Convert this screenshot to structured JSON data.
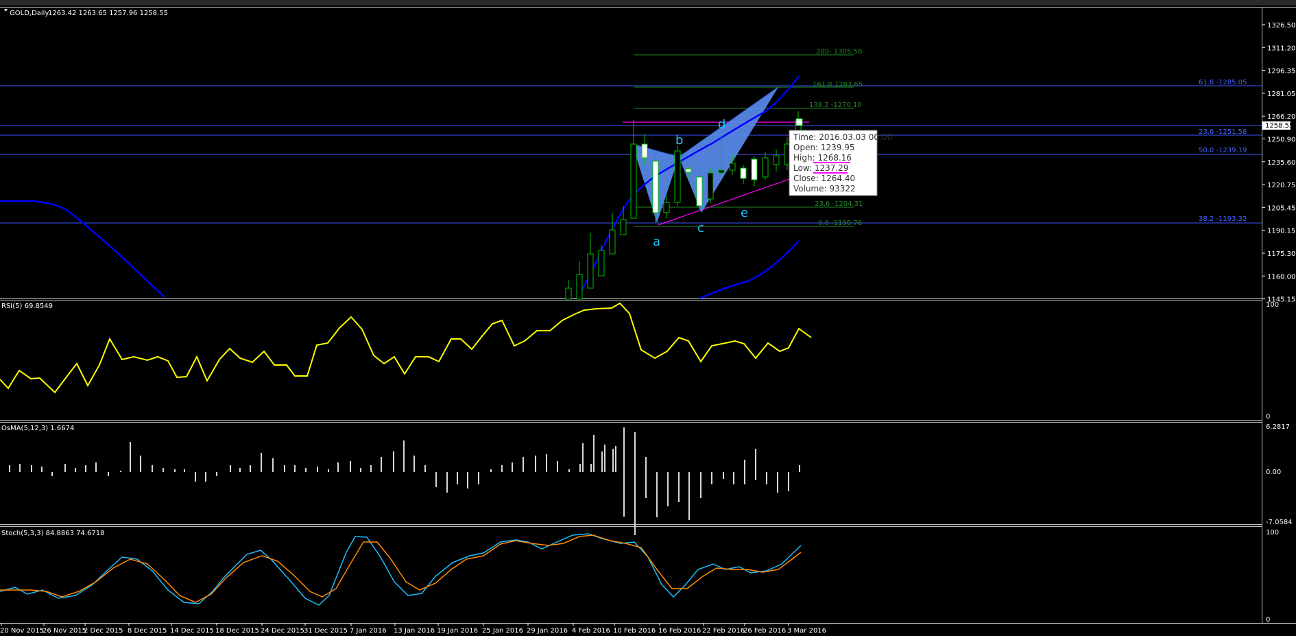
{
  "main": {
    "title": "GOLD,Daily",
    "ohlc": "1263.42 1263.65 1257.96 1258.55",
    "current_price": "1258.55",
    "price_axis": [
      "1326.50",
      "1311.20",
      "1296.35",
      "1281.05",
      "1266.20",
      "1250.90",
      "1235.60",
      "1220.75",
      "1205.45",
      "1190.15",
      "1175.30",
      "1160.00",
      "1145.15"
    ],
    "fib_green": [
      "200- 1305.58",
      "161.8 1283.65",
      "138.2 -1270.10",
      "23.6 -1204.31",
      "0.0 -1190.76"
    ],
    "fib_blue": [
      "61.8 -1285.05",
      "23.6 -1251.58",
      "50.0 -1239.19",
      "38.2 -1193.32"
    ],
    "wave_labels": [
      "a",
      "b",
      "c",
      "d",
      "e"
    ],
    "tooltip": {
      "time": "Time: 2016.03.03 00:00",
      "open": "Open: 1239.95",
      "high": "High: 1268.16",
      "low": "Low:  1237.29",
      "close": "Close: 1264.40",
      "volume": "Volume: 93322"
    }
  },
  "rsi": {
    "title": "RSI(5) 69.8549",
    "max": "100",
    "min": "0"
  },
  "osma": {
    "title": "OsMA(5,12,3) 1.6674",
    "max": "6.2817",
    "mid": "0.00",
    "min": "-7.0584"
  },
  "stoch": {
    "title": "Stoch(5,3,3) 84.8863 74.6718",
    "max": "100",
    "min": "0"
  },
  "dates": [
    "20 Nov 2015",
    "26 Nov 2015",
    "2 Dec 2015",
    "8 Dec 2015",
    "14 Dec 2015",
    "18 Dec 2015",
    "24 Dec 2015",
    "31 Dec 2015",
    "7 Jan 2016",
    "13 Jan 2016",
    "19 Jan 2016",
    "25 Jan 2016",
    "29 Jan 2016",
    "4 Feb 2016",
    "10 Feb 2016",
    "16 Feb 2016",
    "22 Feb 2016",
    "26 Feb 2016",
    "3 Mar 2016"
  ],
  "colors": {
    "bull": "#00c000",
    "line_blue": "#0000ff",
    "level_blue": "#3344cc",
    "rsi": "#ffff00",
    "stoch_main": "#1ec0ff",
    "stoch_signal": "#ff8c00",
    "fib_green": "#228b22",
    "magenta": "#ff00ff",
    "pattern": "#5b8df0"
  }
}
